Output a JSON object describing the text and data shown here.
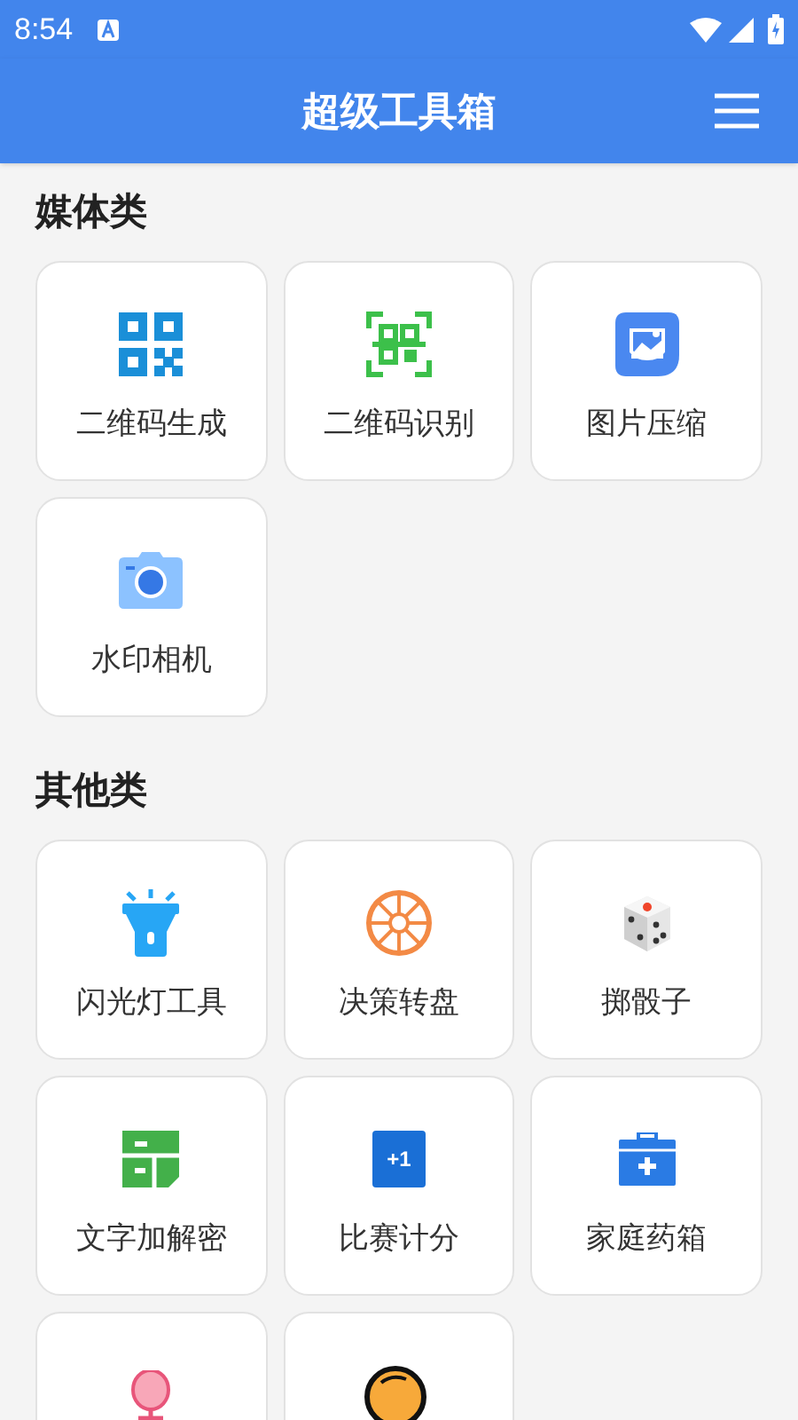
{
  "status_bar": {
    "time": "8:54"
  },
  "app_bar": {
    "title": "超级工具箱"
  },
  "sections": [
    {
      "title": "媒体类",
      "items": [
        {
          "kind": "qr",
          "label": "二维码生成"
        },
        {
          "kind": "scan",
          "label": "二维码识别"
        },
        {
          "kind": "image",
          "label": "图片压缩"
        },
        {
          "kind": "camera",
          "label": "水印相机"
        }
      ]
    },
    {
      "title": "其他类",
      "items": [
        {
          "kind": "flashlight",
          "label": "闪光灯工具"
        },
        {
          "kind": "wheel",
          "label": "决策转盘"
        },
        {
          "kind": "dice",
          "label": "掷骰子"
        },
        {
          "kind": "cipher",
          "label": "文字加解密"
        },
        {
          "kind": "score",
          "label": "比赛计分",
          "badge": "+1"
        },
        {
          "kind": "medkit",
          "label": "家庭药箱"
        },
        {
          "kind": "mirror"
        },
        {
          "kind": "magnifier"
        }
      ]
    }
  ]
}
